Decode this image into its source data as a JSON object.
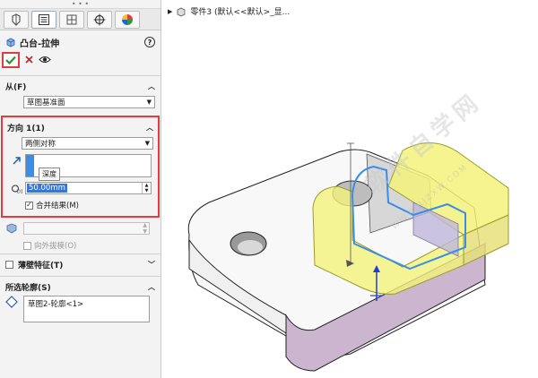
{
  "feature": {
    "title": "凸台-拉伸",
    "help": "?"
  },
  "from_section": {
    "label": "从(F)",
    "selected": "草图基准面"
  },
  "direction1": {
    "label": "方向 1(1)",
    "end_condition": "两侧对称",
    "tooltip": "深度",
    "depth_value": "50.00mm",
    "merge_label": "合并结果(M)"
  },
  "draft": {
    "label": "向外拔模(O)"
  },
  "thin_feature": {
    "label": "薄壁特征(T)"
  },
  "selected_contours": {
    "label": "所选轮廓(S)",
    "items": [
      "草图2-轮廓<1>"
    ]
  },
  "tree_breadcrumb": {
    "text": "零件3 (默认<<默认>_显..."
  },
  "watermark": {
    "text": "软件自学网",
    "url": "WWW.RJZXW.COM"
  },
  "colors": {
    "accent_blue": "#3a8ee6",
    "highlight_red": "#e23c3c",
    "preview_yellow": "#f4f27a"
  }
}
